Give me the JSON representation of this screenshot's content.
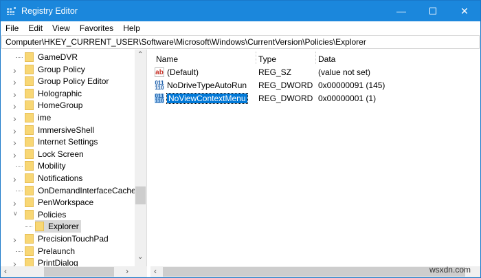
{
  "window": {
    "title": "Registry Editor",
    "controls": [
      "minimize",
      "maximize",
      "close"
    ]
  },
  "menu": [
    "File",
    "Edit",
    "View",
    "Favorites",
    "Help"
  ],
  "address": "Computer\\HKEY_CURRENT_USER\\Software\\Microsoft\\Windows\\CurrentVersion\\Policies\\Explorer",
  "tree": [
    {
      "label": "GameDVR",
      "expander": "none"
    },
    {
      "label": "Group Policy",
      "expander": "collapsed"
    },
    {
      "label": "Group Policy Editor",
      "expander": "collapsed"
    },
    {
      "label": "Holographic",
      "expander": "collapsed"
    },
    {
      "label": "HomeGroup",
      "expander": "collapsed"
    },
    {
      "label": "ime",
      "expander": "collapsed"
    },
    {
      "label": "ImmersiveShell",
      "expander": "collapsed"
    },
    {
      "label": "Internet Settings",
      "expander": "collapsed"
    },
    {
      "label": "Lock Screen",
      "expander": "collapsed"
    },
    {
      "label": "Mobility",
      "expander": "none"
    },
    {
      "label": "Notifications",
      "expander": "collapsed"
    },
    {
      "label": "OnDemandInterfaceCache",
      "expander": "none"
    },
    {
      "label": "PenWorkspace",
      "expander": "collapsed"
    },
    {
      "label": "Policies",
      "expander": "expanded"
    },
    {
      "label": "Explorer",
      "expander": "none",
      "child": true,
      "selected": true
    },
    {
      "label": "PrecisionTouchPad",
      "expander": "collapsed"
    },
    {
      "label": "Prelaunch",
      "expander": "none"
    },
    {
      "label": "PrintDialog",
      "expander": "collapsed"
    }
  ],
  "columns": {
    "name": "Name",
    "type": "Type",
    "data": "Data"
  },
  "values": [
    {
      "icon": "string-value-icon",
      "glyph": "ab",
      "name": "(Default)",
      "type": "REG_SZ",
      "data": "(value not set)"
    },
    {
      "icon": "binary-value-icon",
      "glyph": "011\n110",
      "name": "NoDriveTypeAutoRun",
      "type": "REG_DWORD",
      "data": "0x00000091 (145)"
    },
    {
      "icon": "binary-value-icon",
      "glyph": "011\n110",
      "name": "NoViewContextMenu",
      "type": "REG_DWORD",
      "data": "0x00000001 (1)",
      "selected": true
    }
  ],
  "watermark": "wsxdn.com",
  "colors": {
    "titlebar": "#1b87dc",
    "selection": "#0078d7"
  }
}
